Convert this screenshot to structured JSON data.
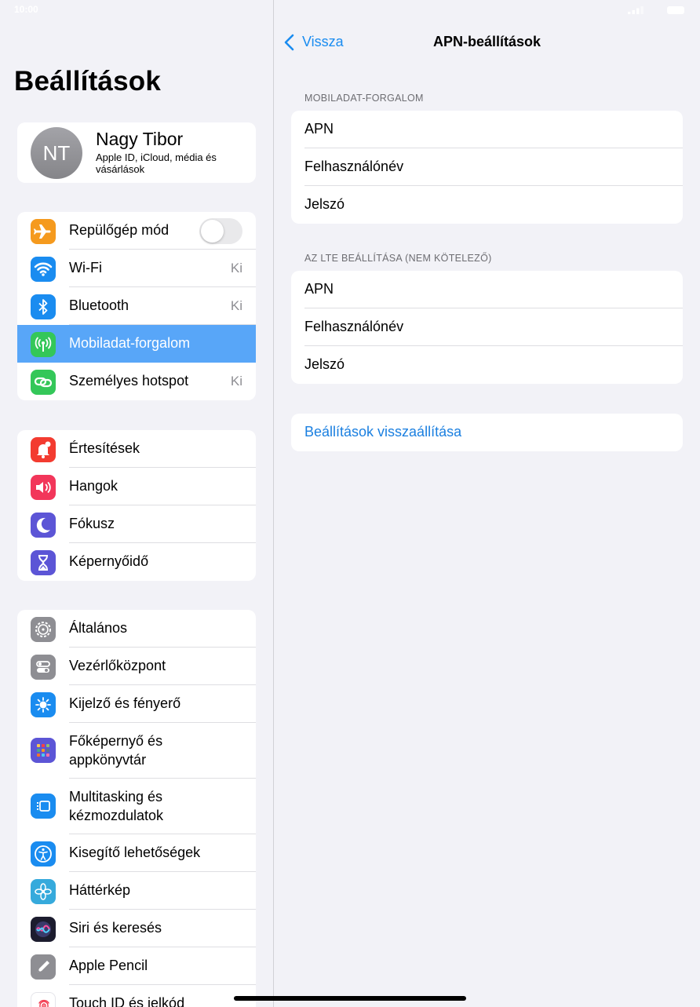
{
  "status_bar": {
    "time": "10:00"
  },
  "sidebar": {
    "title": "Beállítások",
    "profile": {
      "initials": "NT",
      "name": "Nagy Tibor",
      "subtitle": "Apple ID, iCloud, média és vásárlások"
    },
    "group1": [
      {
        "label": "Repülőgép mód",
        "icon": "airplane-icon",
        "color": "#f59a1e",
        "toggle": "off"
      },
      {
        "label": "Wi-Fi",
        "icon": "wifi-icon",
        "color": "#1a8cf0",
        "value": "Ki"
      },
      {
        "label": "Bluetooth",
        "icon": "bluetooth-icon",
        "color": "#1a8cf0",
        "value": "Ki"
      },
      {
        "label": "Mobiladat-forgalom",
        "icon": "antenna-icon",
        "color": "#34c759",
        "selected": true
      },
      {
        "label": "Személyes hotspot",
        "icon": "link-icon",
        "color": "#34c759",
        "value": "Ki"
      }
    ],
    "group2": [
      {
        "label": "Értesítések",
        "icon": "bell-icon",
        "color": "#f33b30"
      },
      {
        "label": "Hangok",
        "icon": "speaker-icon",
        "color": "#f2365a"
      },
      {
        "label": "Fókusz",
        "icon": "moon-icon",
        "color": "#5c55d6"
      },
      {
        "label": "Képernyőidő",
        "icon": "hourglass-icon",
        "color": "#5c55d6"
      }
    ],
    "group3": [
      {
        "label": "Általános",
        "icon": "gear-icon",
        "color": "#8e8e93"
      },
      {
        "label": "Vezérlőközpont",
        "icon": "switches-icon",
        "color": "#8e8e93"
      },
      {
        "label": "Kijelző és fényerő",
        "icon": "sun-icon",
        "color": "#1a8cf0"
      },
      {
        "label": "Főképernyő és appkönyvtár",
        "icon": "home-grid-icon",
        "color": "#5c55d6"
      },
      {
        "label": "Multitasking és kézmozdulatok",
        "icon": "multitasking-icon",
        "color": "#1a8cf0"
      },
      {
        "label": "Kisegítő lehetőségek",
        "icon": "accessibility-icon",
        "color": "#1a8cf0"
      },
      {
        "label": "Háttérkép",
        "icon": "flower-icon",
        "color": "#36aadc"
      },
      {
        "label": "Siri és keresés",
        "icon": "siri-icon",
        "color": "#1c1c2e"
      },
      {
        "label": "Apple Pencil",
        "icon": "pencil-icon",
        "color": "#8e8e93"
      },
      {
        "label": "Touch ID és jelkód",
        "icon": "fingerprint-icon",
        "color": "#f33b50"
      }
    ]
  },
  "detail": {
    "back_label": "Vissza",
    "title": "APN-beállítások",
    "section1": {
      "header": "MOBILADAT-FORGALOM",
      "rows": [
        "APN",
        "Felhasználónév",
        "Jelszó"
      ]
    },
    "section2": {
      "header": "AZ LTE BEÁLLÍTÁSA (NEM KÖTELEZŐ)",
      "rows": [
        "APN",
        "Felhasználónév",
        "Jelszó"
      ]
    },
    "reset_label": "Beállítások visszaállítása"
  }
}
